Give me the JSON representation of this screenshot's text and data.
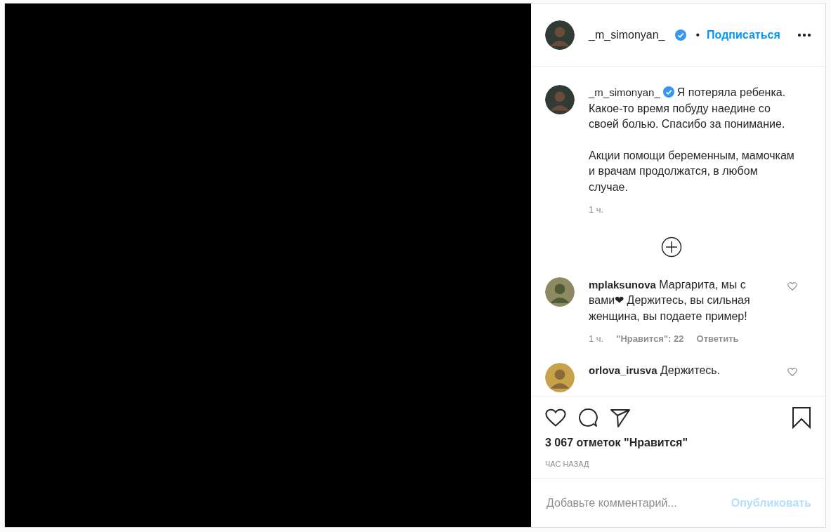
{
  "header": {
    "username": "_m_simonyan_",
    "verified": true,
    "dot": "•",
    "follow": "Подписаться"
  },
  "caption": {
    "username": "_m_simonyan_",
    "verified": true,
    "paragraphs": [
      "Я потеряла ребенка. Какое-то время побуду наедине со своей болью. Спасибо за понимание.",
      "Акции помощи беременным, мамочкам и врачам продолжатся, в любом случае."
    ],
    "time": "1 ч."
  },
  "comments": [
    {
      "username": "mplaksunova",
      "text": "Маргарита, мы с вами❤ Держитесь, вы сильная женщина, вы подаете пример!",
      "time": "1 ч.",
      "likes": "\"Нравится\": 22",
      "reply": "Ответить",
      "liked": false
    },
    {
      "username": "orlova_irusva",
      "text": "Держитесь.",
      "liked": false
    }
  ],
  "actions": {
    "liked": false,
    "saved": false
  },
  "likes_count": "3 067 отметок \"Нравится\"",
  "time_ago": "ЧАС НАЗАД",
  "comment_field": {
    "placeholder": "Добавьте комментарий..."
  },
  "publish": {
    "label": "Опубликовать",
    "disabled": true
  }
}
